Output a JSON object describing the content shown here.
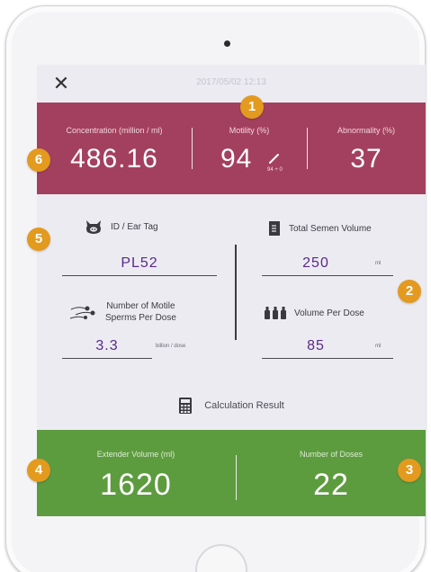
{
  "header": {
    "close_label": "✕",
    "datetime": "2017/05/02 12:13"
  },
  "metrics": {
    "concentration": {
      "label": "Concentration (million / ml)",
      "value": "486.16"
    },
    "motility": {
      "label": "Motility (%)",
      "value": "94",
      "sub": "94 + 0"
    },
    "abnormality": {
      "label": "Abnormality (%)",
      "value": "37"
    }
  },
  "fields": {
    "id_tag": {
      "label": "ID / Ear Tag",
      "value": "PL52",
      "icon": "pig-icon"
    },
    "total_volume": {
      "label": "Total Semen Volume",
      "value": "250",
      "unit": "ml",
      "icon": "beaker-icon"
    },
    "motile_sperms": {
      "label_line1": "Number of Motile",
      "label_line2": "Sperms Per Dose",
      "value": "3.3",
      "unit": "billion / dose",
      "icon": "sperm-icon"
    },
    "volume_per_dose": {
      "label": "Volume Per Dose",
      "value": "85",
      "unit": "ml",
      "icon": "bottles-icon"
    }
  },
  "calc": {
    "label": "Calculation Result",
    "icon": "calculator-icon"
  },
  "results": {
    "extender": {
      "label": "Extender Volume (ml)",
      "value": "1620"
    },
    "doses": {
      "label": "Number of Doses",
      "value": "22"
    }
  },
  "badges": [
    "1",
    "2",
    "3",
    "4",
    "5",
    "6"
  ],
  "colors": {
    "top_band": "#a4405f",
    "bottom_band": "#5d9b3f",
    "badge": "#e39a1f",
    "value_text": "#5a2a8a"
  }
}
